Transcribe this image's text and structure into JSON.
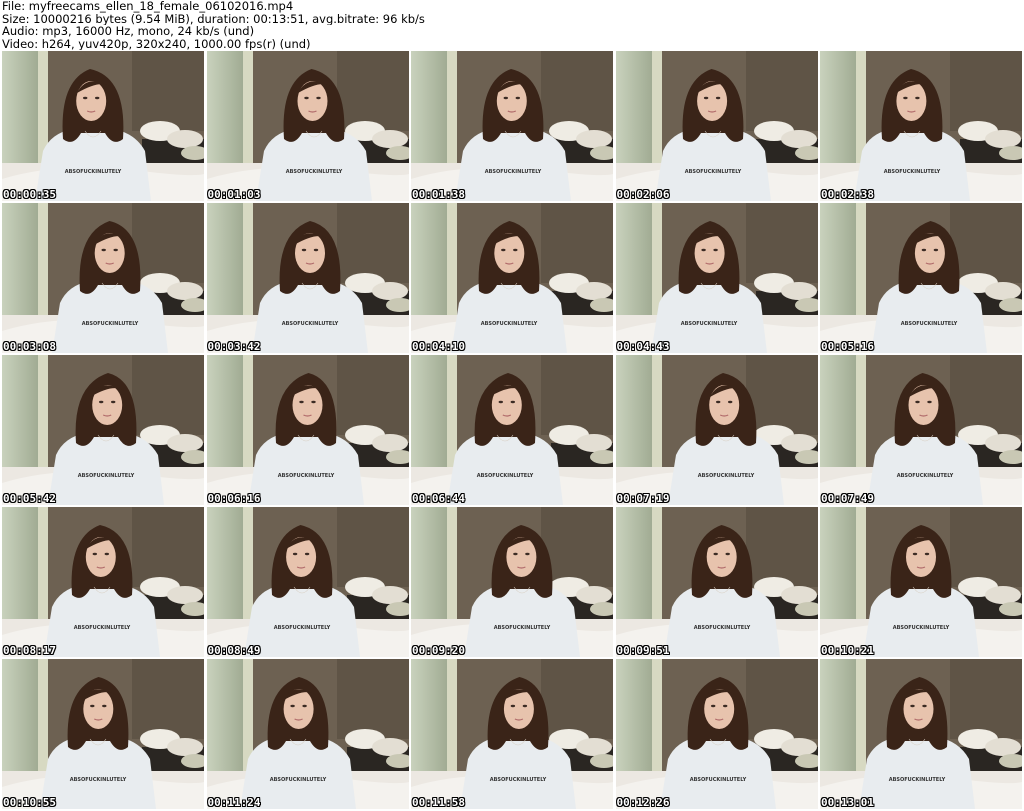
{
  "header": {
    "lines": [
      "File: myfreecams_ellen_18_female_06102016.mp4",
      "Size: 10000216 bytes (9.54 MiB), duration: 00:13:51, avg.bitrate: 96 kb/s",
      "Audio: mp3, 16000 Hz, mono, 24 kb/s (und)",
      "Video: h264, yuv420p, 320x240, 1000.00 fps(r) (und)"
    ]
  },
  "thumbnails": [
    {
      "timestamp": "00:00:35"
    },
    {
      "timestamp": "00:01:03"
    },
    {
      "timestamp": "00:01:38"
    },
    {
      "timestamp": "00:02:06"
    },
    {
      "timestamp": "00:02:38"
    },
    {
      "timestamp": "00:03:08"
    },
    {
      "timestamp": "00:03:42"
    },
    {
      "timestamp": "00:04:10"
    },
    {
      "timestamp": "00:04:43"
    },
    {
      "timestamp": "00:05:16"
    },
    {
      "timestamp": "00:05:42"
    },
    {
      "timestamp": "00:06:16"
    },
    {
      "timestamp": "00:06:44"
    },
    {
      "timestamp": "00:07:19"
    },
    {
      "timestamp": "00:07:49"
    },
    {
      "timestamp": "00:08:17"
    },
    {
      "timestamp": "00:08:49"
    },
    {
      "timestamp": "00:09:20"
    },
    {
      "timestamp": "00:09:51"
    },
    {
      "timestamp": "00:10:21"
    },
    {
      "timestamp": "00:10:55"
    },
    {
      "timestamp": "00:11:24"
    },
    {
      "timestamp": "00:11:58"
    },
    {
      "timestamp": "00:12:26"
    },
    {
      "timestamp": "00:13:01"
    }
  ],
  "shirt_text": "ABSOFUCKINLUTELY",
  "colors": {
    "wall_left": "#9aa58c",
    "wall_right": "#6d6152",
    "shirt": "#e8ecef",
    "hair": "#3a2418",
    "skin": "#e7c3ad",
    "pillow": "#efece4",
    "bed": "#2a2622",
    "timestamp_text": "#ffffff"
  }
}
